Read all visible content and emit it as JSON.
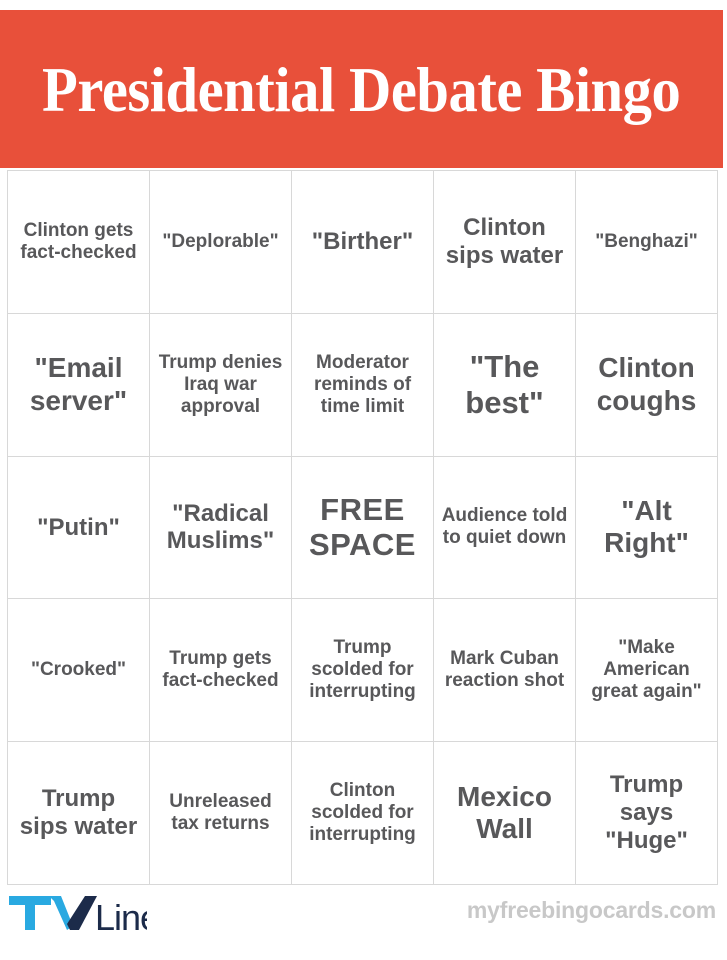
{
  "header": {
    "title": "Presidential Debate Bingo",
    "background_color": "#e8503a",
    "text_color": "#ffffff"
  },
  "grid": {
    "columns": 5,
    "rows": 5,
    "border_color": "#d8d8d8",
    "text_color": "#58585a",
    "cells": [
      {
        "text": "Clinton gets fact-checked",
        "size": "sz-sm"
      },
      {
        "text": "\"Deplorable\"",
        "size": "sz-sm"
      },
      {
        "text": "\"Birther\"",
        "size": "sz-md"
      },
      {
        "text": "Clinton sips water",
        "size": "sz-md"
      },
      {
        "text": "\"Benghazi\"",
        "size": "sz-sm"
      },
      {
        "text": "\"Email server\"",
        "size": "sz-lg"
      },
      {
        "text": "Trump denies Iraq war approval",
        "size": "sz-sm"
      },
      {
        "text": "Moderator reminds of time limit",
        "size": "sz-sm"
      },
      {
        "text": "\"The best\"",
        "size": "sz-xl"
      },
      {
        "text": "Clinton coughs",
        "size": "sz-lg"
      },
      {
        "text": "\"Putin\"",
        "size": "sz-md"
      },
      {
        "text": "\"Radical Muslims\"",
        "size": "sz-md"
      },
      {
        "text": "FREE SPACE",
        "size": "sz-free"
      },
      {
        "text": "Audience told to quiet down",
        "size": "sz-sm"
      },
      {
        "text": "\"Alt Right\"",
        "size": "sz-lg"
      },
      {
        "text": "\"Crooked\"",
        "size": "sz-sm"
      },
      {
        "text": "Trump gets fact-checked",
        "size": "sz-sm"
      },
      {
        "text": "Trump scolded for interrupting",
        "size": "sz-sm"
      },
      {
        "text": "Mark Cuban reaction shot",
        "size": "sz-sm"
      },
      {
        "text": "\"Make American great again\"",
        "size": "sz-sm"
      },
      {
        "text": "Trump sips water",
        "size": "sz-md"
      },
      {
        "text": "Unreleased tax returns",
        "size": "sz-sm"
      },
      {
        "text": "Clinton scolded for interrupting",
        "size": "sz-sm"
      },
      {
        "text": "Mexico Wall",
        "size": "sz-lg"
      },
      {
        "text": "Trump says \"Huge\"",
        "size": "sz-md"
      }
    ]
  },
  "footer": {
    "logo": {
      "tv_text": "TV",
      "line_text": "Line",
      "tv_color": "#29a9e1",
      "line_color": "#1c2b4a"
    },
    "site_url": "myfreebingocards.com",
    "site_url_color": "#c8c8c8"
  }
}
